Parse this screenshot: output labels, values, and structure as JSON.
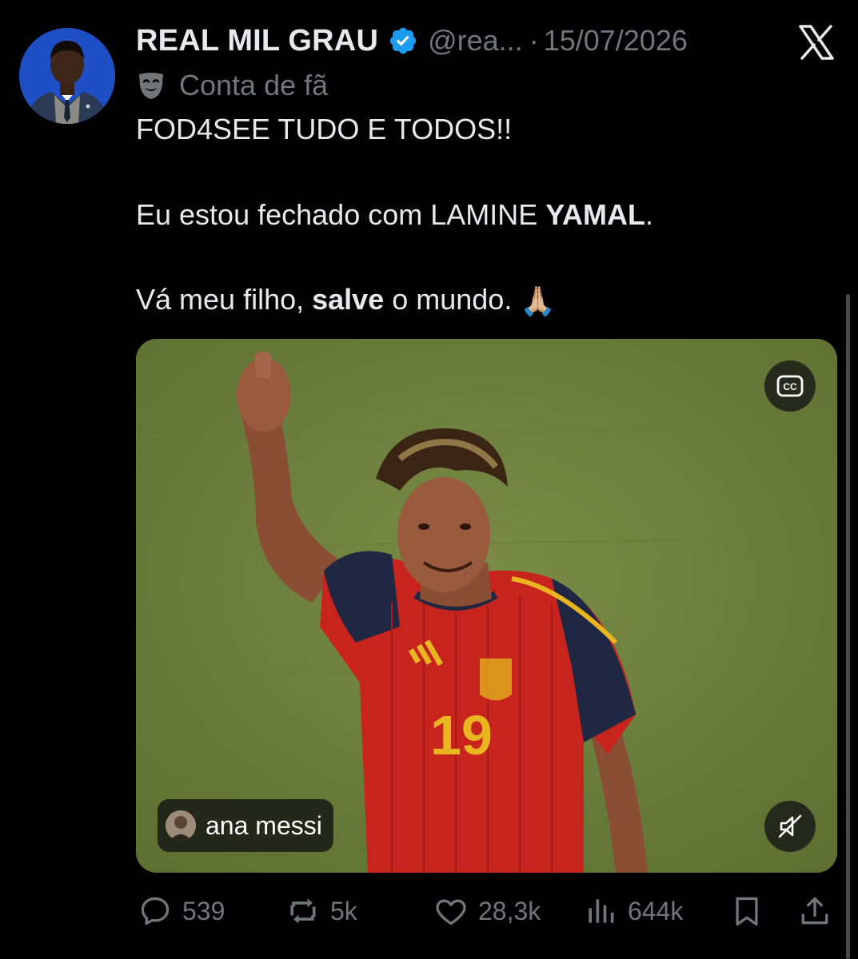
{
  "tweet": {
    "display_name": "REAL MIL GRAU",
    "handle": "@rea...",
    "separator": "·",
    "date": "15/07/2026",
    "fan_label": "Conta de fã",
    "text": {
      "line1": "FOD4SEE TUDO E TODOS!!",
      "line2_a": "Eu estou fechado com LAMINE ",
      "line2_b": "YAMAL",
      "line2_c": ".",
      "line3_a": "Vá meu filho, ",
      "line3_b": "salve",
      "line3_c": " o mundo. ",
      "emoji": "🙏🏼"
    }
  },
  "media": {
    "tagged_user": "ana messi",
    "jersey_number": "19",
    "cc_icon": "closed-captions-icon",
    "mute_icon": "muted-speaker-icon"
  },
  "actions": {
    "replies": "539",
    "reposts": "5k",
    "likes": "28,3k",
    "views": "644k"
  },
  "colors": {
    "background": "#000000",
    "text": "#e7e9ea",
    "secondary": "#71767b",
    "verified": "#1d9bf0",
    "avatar_bg": "#1e4fc4"
  }
}
